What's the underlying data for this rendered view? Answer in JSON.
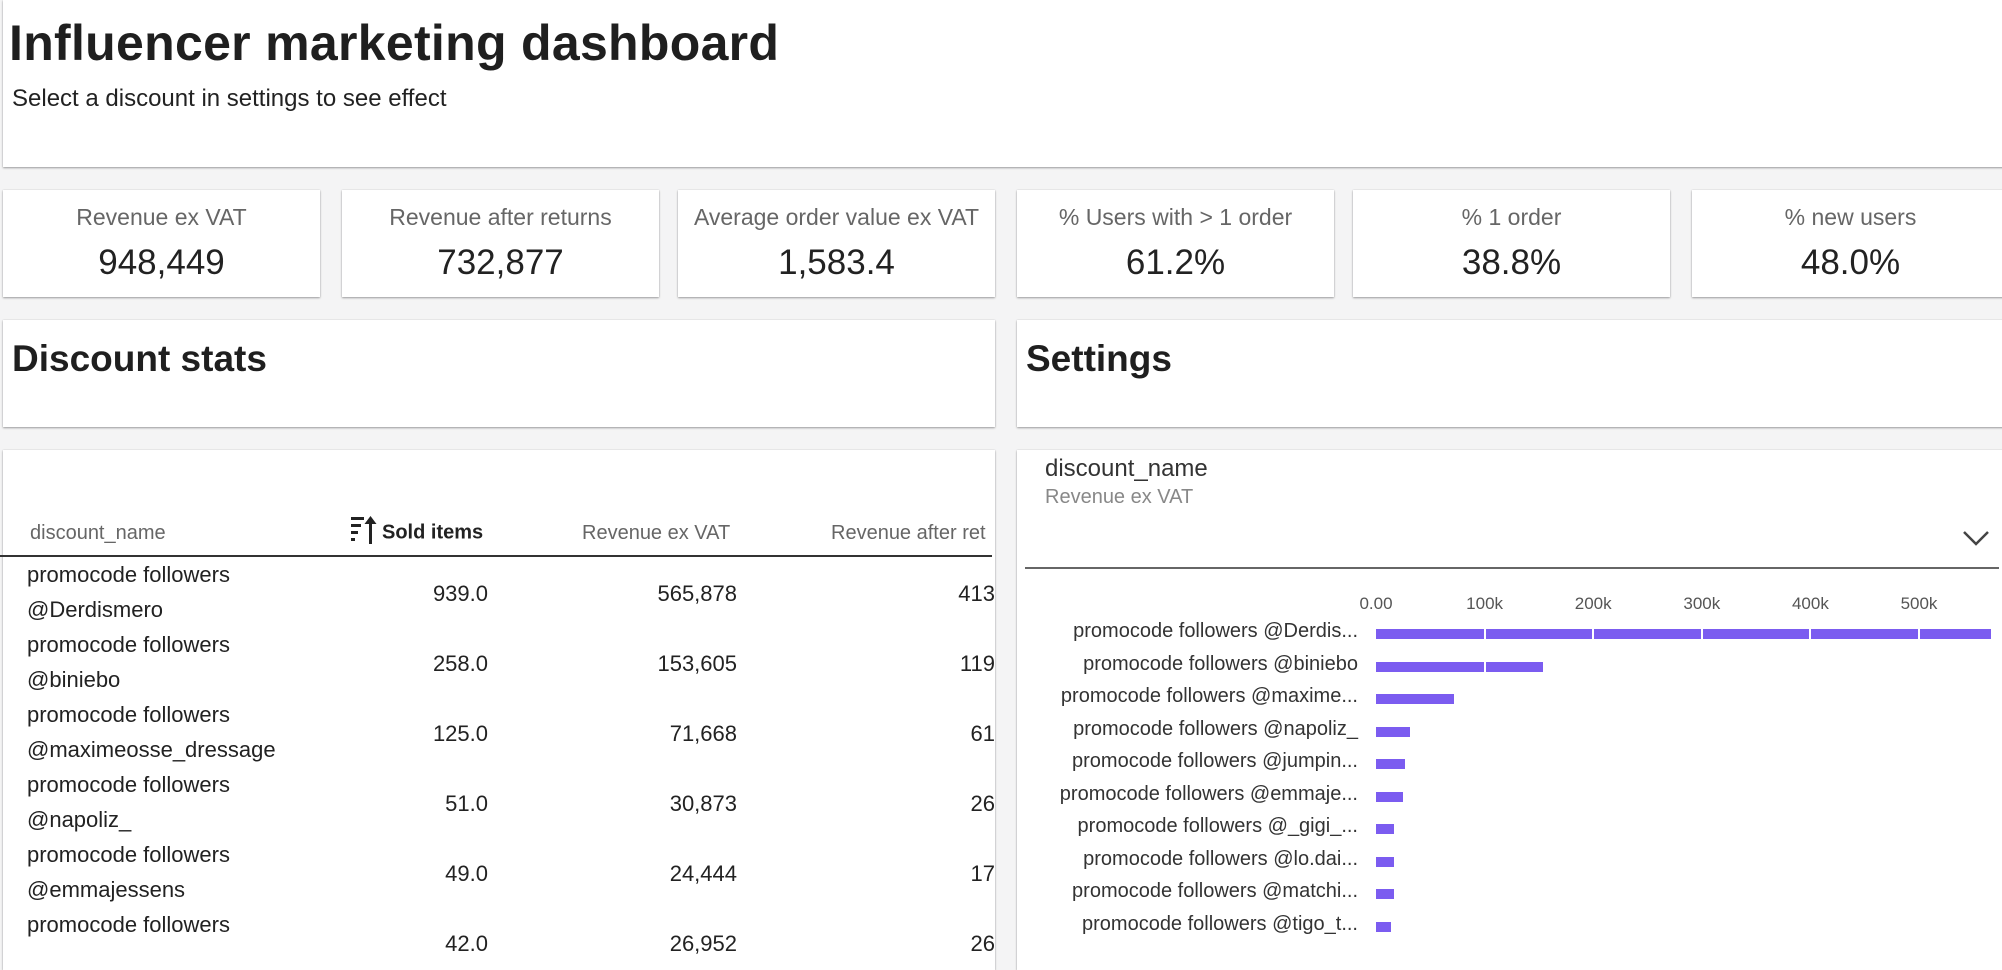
{
  "header": {
    "title": "Influencer marketing dashboard",
    "subtitle": "Select a discount in settings to see effect"
  },
  "kpis": [
    {
      "label": "Revenue ex VAT",
      "value": "948,449"
    },
    {
      "label": "Revenue after returns",
      "value": "732,877"
    },
    {
      "label": "Average order value ex VAT",
      "value": "1,583.4"
    },
    {
      "label": "% Users with > 1 order",
      "value": "61.2%"
    },
    {
      "label": "% 1 order",
      "value": "38.8%"
    },
    {
      "label": "% new users",
      "value": "48.0%"
    }
  ],
  "sections": {
    "discount_stats": "Discount stats",
    "settings": "Settings"
  },
  "table": {
    "columns": [
      "discount_name",
      "Sold items",
      "Revenue ex VAT",
      "Revenue after ret"
    ],
    "sorted_column": "Sold items",
    "sort_direction": "descending",
    "rows": [
      {
        "name": "promocode followers @Derdismero",
        "sold": "939.0",
        "revenue": "565,878",
        "after": "413"
      },
      {
        "name": "promocode followers @biniebo",
        "sold": "258.0",
        "revenue": "153,605",
        "after": "119"
      },
      {
        "name": "promocode followers @maximeosse_dressage",
        "sold": "125.0",
        "revenue": "71,668",
        "after": "61"
      },
      {
        "name": "promocode followers @napoliz_",
        "sold": "51.0",
        "revenue": "30,873",
        "after": "26"
      },
      {
        "name": "promocode followers @emmajessens",
        "sold": "49.0",
        "revenue": "24,444",
        "after": "17"
      },
      {
        "name": "promocode followers",
        "sold": "42.0",
        "revenue": "26,952",
        "after": "26"
      }
    ]
  },
  "filter": {
    "title": "discount_name",
    "subtitle": "Revenue ex VAT",
    "icon": "chevron-down-icon"
  },
  "chart_data": {
    "type": "bar",
    "orientation": "horizontal",
    "color": "#7b5cf0",
    "x_ticks": [
      "0.00",
      "100k",
      "200k",
      "300k",
      "400k",
      "500k"
    ],
    "xlim": [
      0,
      580000
    ],
    "categories": [
      "promocode followers @Derdis...",
      "promocode followers @biniebo",
      "promocode followers @maxime...",
      "promocode followers @napoliz_",
      "promocode followers @jumpin...",
      "promocode followers @emmaje...",
      "promocode followers @_gigi_...",
      "promocode followers @lo.dai...",
      "promocode followers @matchi...",
      "promocode followers @tigo_t..."
    ],
    "values": [
      565878,
      153605,
      71668,
      30873,
      27000,
      24444,
      17000,
      17000,
      17000,
      14000
    ]
  }
}
